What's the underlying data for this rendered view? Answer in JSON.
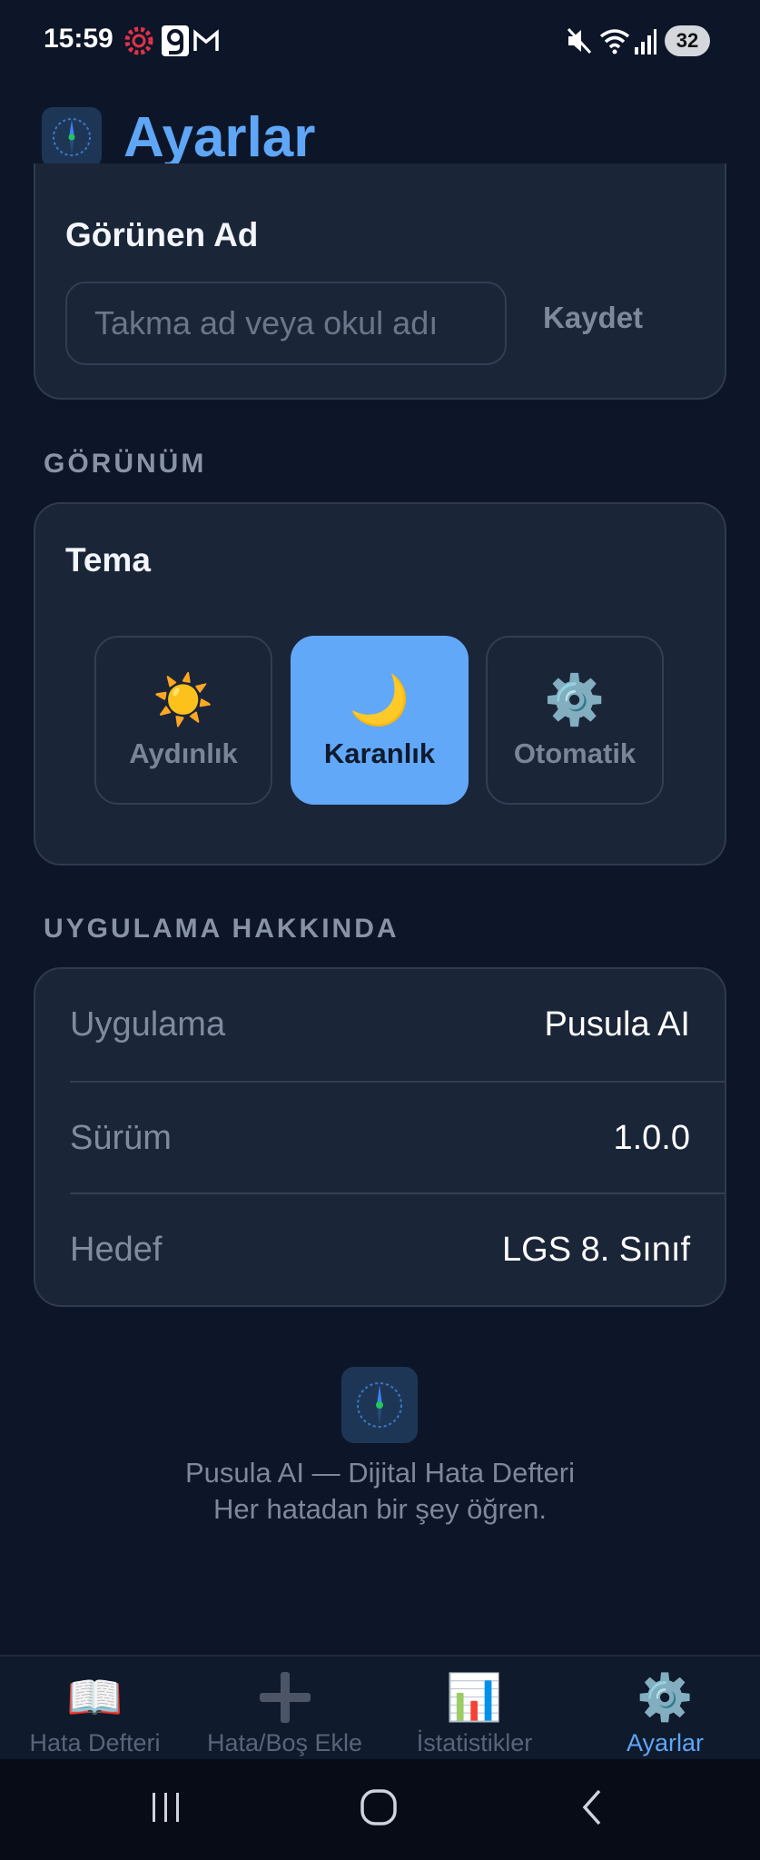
{
  "status_bar": {
    "time": "15:59",
    "battery": "32",
    "icons": [
      "gear-badge-icon",
      "g-app-icon",
      "gmail-icon",
      "mute-icon",
      "wifi-icon",
      "signal-icon"
    ]
  },
  "header": {
    "title": "Ayarlar",
    "logo_icon": "compass-icon"
  },
  "profile": {
    "label": "Görünen Ad",
    "input_value": "",
    "input_placeholder": "Takma ad veya okul adı",
    "save_label": "Kaydet"
  },
  "appearance": {
    "section_label": "GÖRÜNÜM",
    "theme_label": "Tema",
    "options": [
      {
        "icon": "☀️",
        "label": "Aydınlık"
      },
      {
        "icon": "🌙",
        "label": "Karanlık"
      },
      {
        "icon": "⚙️",
        "label": "Otomatik"
      }
    ],
    "selected": "Karanlık"
  },
  "about": {
    "section_label": "UYGULAMA HAKKINDA",
    "rows": [
      {
        "key": "Uygulama",
        "value": "Pusula AI"
      },
      {
        "key": "Sürüm",
        "value": "1.0.0"
      },
      {
        "key": "Hedef",
        "value": "LGS 8. Sınıf"
      }
    ]
  },
  "footer": {
    "line1": "Pusula AI — Dijital Hata Defteri",
    "line2": "Her hatadan bir şey öğren."
  },
  "nav": {
    "items": [
      {
        "icon": "📖",
        "label": "Hata Defteri"
      },
      {
        "icon": "",
        "label": "Hata/Boş Ekle"
      },
      {
        "icon": "📊",
        "label": "İstatistikler"
      },
      {
        "icon": "⚙️",
        "label": "Ayarlar"
      }
    ],
    "active": "Ayarlar"
  },
  "colors": {
    "background": "#0d1628",
    "card": "#1b2538",
    "accent": "#5fa6f6",
    "active_option": "#62a8f8"
  }
}
